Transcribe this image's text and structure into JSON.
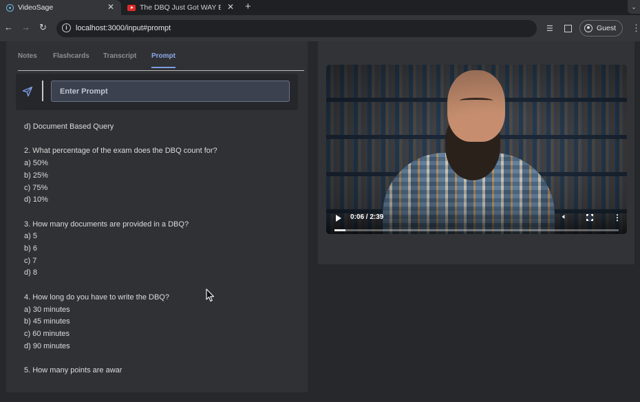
{
  "browser": {
    "tabs": [
      {
        "title": "VideoSage",
        "active": true,
        "icon": "react-icon"
      },
      {
        "title": "The DBQ Just Got WAY EASI",
        "active": false,
        "icon": "youtube-icon"
      }
    ],
    "url": "localhost:3000/input#prompt",
    "profile_label": "Guest"
  },
  "app": {
    "tabs": [
      "Notes",
      "Flashcards",
      "Transcript",
      "Prompt"
    ],
    "active_tab": "Prompt",
    "prompt_placeholder": "Enter Prompt",
    "accent_color": "#7d9ee6",
    "content_lines": [
      "d) Document Based Query",
      "",
      "2. What percentage of the exam does the DBQ count for?",
      "a) 50%",
      "b) 25%",
      "c) 75%",
      "d) 10%",
      "",
      "3. How many documents are provided in a DBQ?",
      "a) 5",
      "b) 6",
      "c) 7",
      "d) 8",
      "",
      "4. How long do you have to write the DBQ?",
      "a) 30 minutes",
      "b) 45 minutes",
      "c) 60 minutes",
      "d) 90 minutes",
      "",
      "5. How many points are awar"
    ]
  },
  "video": {
    "time_display": "0:06 / 2:39",
    "progress_fraction": 0.038
  }
}
